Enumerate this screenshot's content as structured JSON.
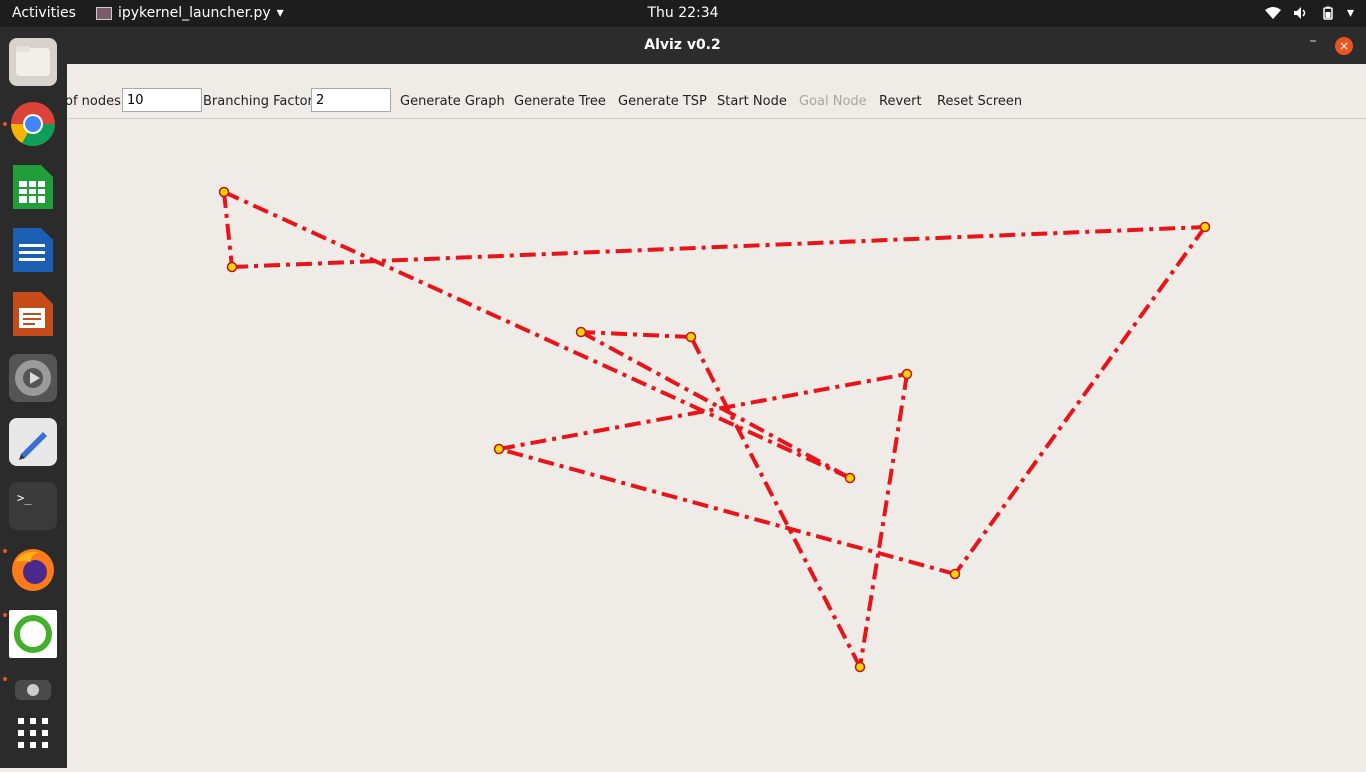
{
  "topbar": {
    "activities": "Activities",
    "app_name": "ipykernel_launcher.py",
    "clock": "Thu 22:34"
  },
  "dock": {
    "items": [
      "files",
      "chrome",
      "calc",
      "writer",
      "impress",
      "settings",
      "text-editor",
      "terminal",
      "firefox",
      "anaconda",
      "camera",
      "show-applications"
    ]
  },
  "window": {
    "title": "Alviz v0.2",
    "minimize": "–",
    "close": "×"
  },
  "toolbar": {
    "nodes_label": "of nodes:",
    "nodes_value": "10",
    "branching_label": "Branching Factor:",
    "branching_value": "2",
    "generate_graph": "Generate Graph",
    "generate_tree": "Generate Tree",
    "generate_tsp": "Generate TSP",
    "start_node": "Start Node",
    "goal_node": "Goal Node",
    "revert": "Revert",
    "reset_screen": "Reset Screen"
  },
  "graph": {
    "edge_color": "#e8141a",
    "node_fill": "#f2d600",
    "node_stroke": "#c8101a",
    "node_ids": [
      0,
      1,
      2,
      3,
      4,
      5,
      6,
      7,
      8,
      9
    ],
    "edges": [
      [
        0,
        1
      ],
      [
        1,
        2
      ],
      [
        2,
        3
      ],
      [
        3,
        4
      ],
      [
        4,
        5
      ],
      [
        5,
        6
      ],
      [
        6,
        7
      ],
      [
        7,
        8
      ],
      [
        8,
        9
      ],
      [
        9,
        0
      ]
    ]
  }
}
